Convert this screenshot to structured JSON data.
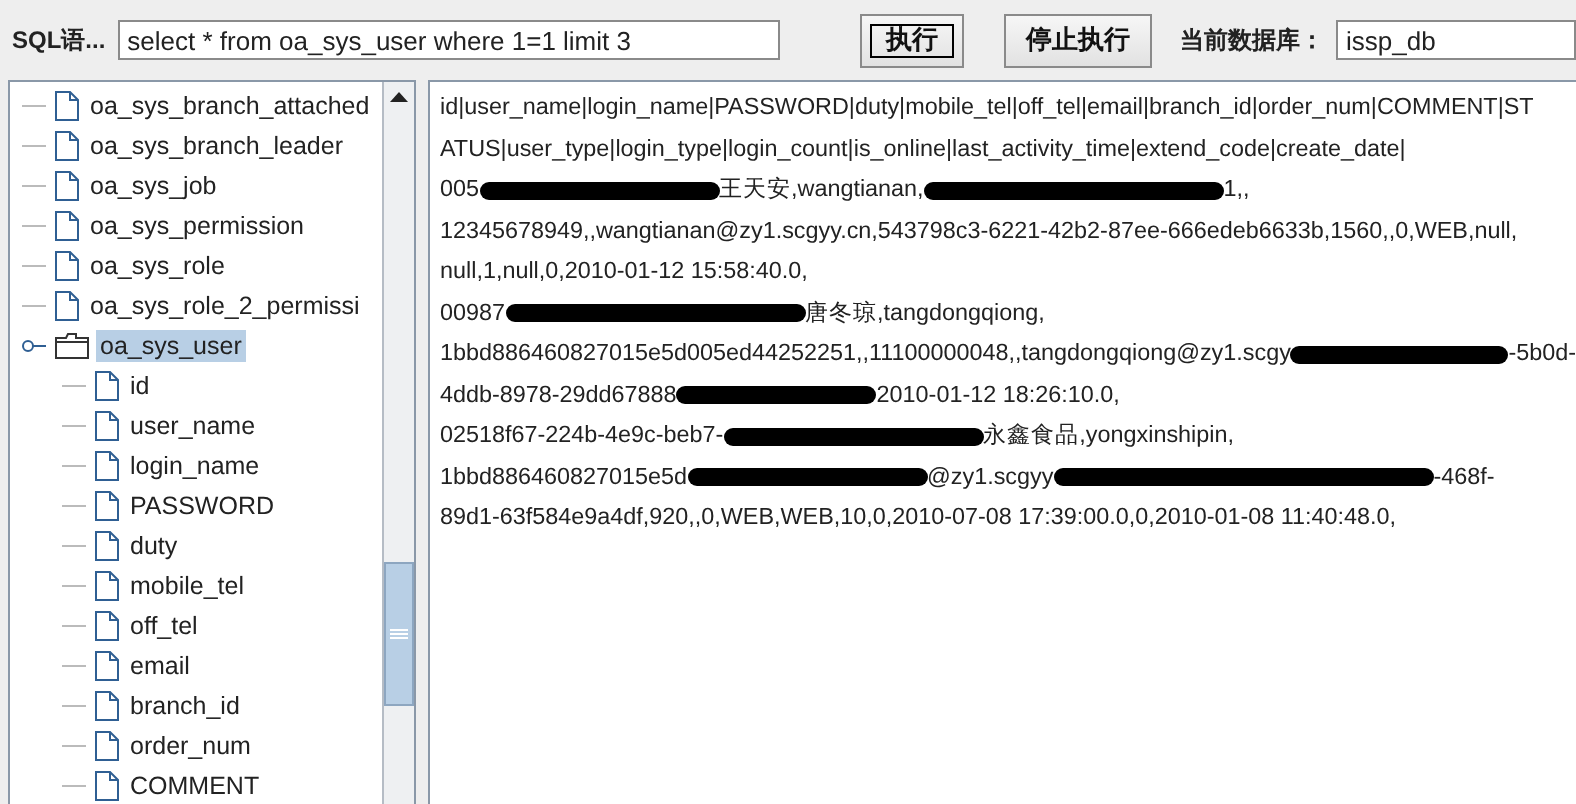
{
  "toolbar": {
    "sql_label": "SQL语...",
    "sql_value": "select * from oa_sys_user where 1=1 limit 3",
    "buttons": [
      {
        "label": "执行",
        "focused": true
      },
      {
        "label": "停止执行",
        "focused": false
      }
    ],
    "db_label": "当前数据库：",
    "db_value": "issp_db"
  },
  "tree": {
    "items": [
      {
        "name": "oa_sys_branch_attached",
        "kind": "file",
        "selected": false
      },
      {
        "name": "oa_sys_branch_leader",
        "kind": "file",
        "selected": false
      },
      {
        "name": "oa_sys_job",
        "kind": "file",
        "selected": false
      },
      {
        "name": "oa_sys_permission",
        "kind": "file",
        "selected": false
      },
      {
        "name": "oa_sys_role",
        "kind": "file",
        "selected": false
      },
      {
        "name": "oa_sys_role_2_permissi",
        "kind": "file",
        "selected": false
      },
      {
        "name": "oa_sys_user",
        "kind": "folder",
        "selected": true,
        "expanded": true,
        "children": [
          {
            "name": "id",
            "kind": "file",
            "selected": false
          },
          {
            "name": "user_name",
            "kind": "file",
            "selected": false
          },
          {
            "name": "login_name",
            "kind": "file",
            "selected": false
          },
          {
            "name": "PASSWORD",
            "kind": "file",
            "selected": false
          },
          {
            "name": "duty",
            "kind": "file",
            "selected": false
          },
          {
            "name": "mobile_tel",
            "kind": "file",
            "selected": false
          },
          {
            "name": "off_tel",
            "kind": "file",
            "selected": false
          },
          {
            "name": "email",
            "kind": "file",
            "selected": false
          },
          {
            "name": "branch_id",
            "kind": "file",
            "selected": false
          },
          {
            "name": "order_num",
            "kind": "file",
            "selected": false
          },
          {
            "name": "COMMENT",
            "kind": "file",
            "selected": false
          }
        ]
      }
    ]
  },
  "result_lines": [
    [
      {
        "kind": "text",
        "text": "id|user_name|login_name|PASSWORD|duty|mobile_tel|off_tel|email|branch_id|order_num|COMMENT|ST"
      }
    ],
    [
      {
        "kind": "text",
        "text": "ATUS|user_type|login_type|login_count|is_online|last_activity_time|extend_code|create_date|"
      }
    ],
    [
      {
        "kind": "text",
        "text": "005"
      },
      {
        "kind": "redaction"
      },
      {
        "kind": "text",
        "text": "王天安,wangtianan,"
      },
      {
        "kind": "redaction"
      },
      {
        "kind": "text",
        "text": "1,,"
      }
    ],
    [
      {
        "kind": "text",
        "text": "12345678949,,wangtianan@zy1.scgyy.cn,543798c3-6221-42b2-87ee-666edeb6633b,1560,,0,WEB,null,"
      }
    ],
    [
      {
        "kind": "text",
        "text": "null,1,null,0,2010-01-12 15:58:40.0,"
      }
    ],
    [
      {
        "kind": "text",
        "text": "00987"
      },
      {
        "kind": "redaction"
      },
      {
        "kind": "text",
        "text": "唐冬琼,tangdongqiong,"
      }
    ],
    [
      {
        "kind": "text",
        "text": "1bbd886460827015e5d005ed44252251,,11100000048,,tangdongqiong@zy1.scgy"
      },
      {
        "kind": "redaction"
      },
      {
        "kind": "text",
        "text": "-5b0d-"
      }
    ],
    [
      {
        "kind": "text",
        "text": "4ddb-8978-29dd67888"
      },
      {
        "kind": "redaction"
      },
      {
        "kind": "text",
        "text": "2010-01-12 18:26:10.0,"
      }
    ],
    [
      {
        "kind": "text",
        "text": "02518f67-224b-4e9c-beb7-"
      },
      {
        "kind": "redaction"
      },
      {
        "kind": "text",
        "text": "永鑫食品,yongxinshipin,"
      }
    ],
    [
      {
        "kind": "text",
        "text": "1bbd886460827015e5d"
      },
      {
        "kind": "redaction"
      },
      {
        "kind": "text",
        "text": "@zy1.scgyy"
      },
      {
        "kind": "redaction"
      },
      {
        "kind": "text",
        "text": "-468f-"
      }
    ],
    [
      {
        "kind": "text",
        "text": "89d1-63f584e9a4df,920,,0,WEB,WEB,10,0,2010-07-08 17:39:00.0,0,2010-01-08 11:40:48.0,"
      }
    ]
  ]
}
